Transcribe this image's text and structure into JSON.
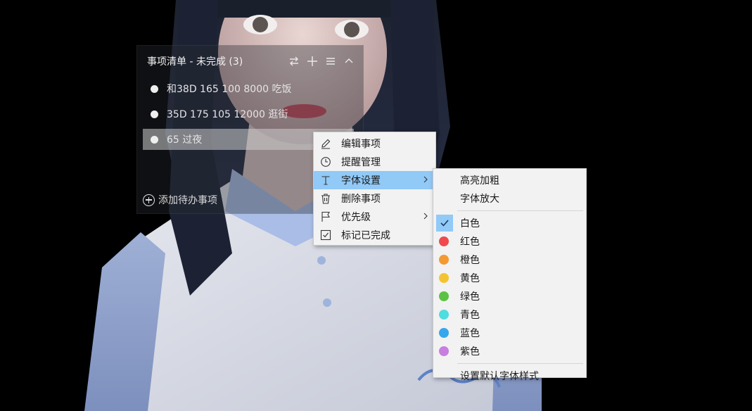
{
  "widget": {
    "title": "事项清单 - 未完成 (3)",
    "tools": [
      {
        "name": "swap-icon"
      },
      {
        "name": "plus-icon"
      },
      {
        "name": "menu-icon"
      },
      {
        "name": "chevron-up-icon"
      }
    ],
    "items": [
      {
        "text": "和38D 165 100 8000 吃饭"
      },
      {
        "text": "35D 175 105 12000  逛街"
      },
      {
        "text": "65  过夜"
      }
    ],
    "add_label": "添加待办事项"
  },
  "context_menu": {
    "items": [
      {
        "label": "编辑事项",
        "icon": "pencil-icon"
      },
      {
        "label": "提醒管理",
        "icon": "clock-icon"
      },
      {
        "label": "字体设置",
        "icon": "text-icon",
        "submenu": true,
        "active": true
      },
      {
        "label": "删除事项",
        "icon": "trash-icon"
      },
      {
        "label": "优先级",
        "icon": "flag-icon",
        "submenu": true
      },
      {
        "label": "标记已完成",
        "icon": "checkbox-icon"
      }
    ]
  },
  "font_submenu": {
    "top_items": [
      {
        "label": "高亮加粗"
      },
      {
        "label": "字体放大"
      }
    ],
    "colors": [
      {
        "label": "白色",
        "checked": true,
        "color": "#ffffff"
      },
      {
        "label": "红色",
        "color": "#f0484b"
      },
      {
        "label": "橙色",
        "color": "#f39a32"
      },
      {
        "label": "黄色",
        "color": "#f4c430"
      },
      {
        "label": "绿色",
        "color": "#5cc246"
      },
      {
        "label": "青色",
        "color": "#4fdde0"
      },
      {
        "label": "蓝色",
        "color": "#35a7ec"
      },
      {
        "label": "紫色",
        "color": "#c87ee0"
      }
    ],
    "reset_label": "设置默认字体样式"
  },
  "theme": {
    "menu_highlight": "#91c9f7",
    "menu_background": "#f2f2f2"
  }
}
